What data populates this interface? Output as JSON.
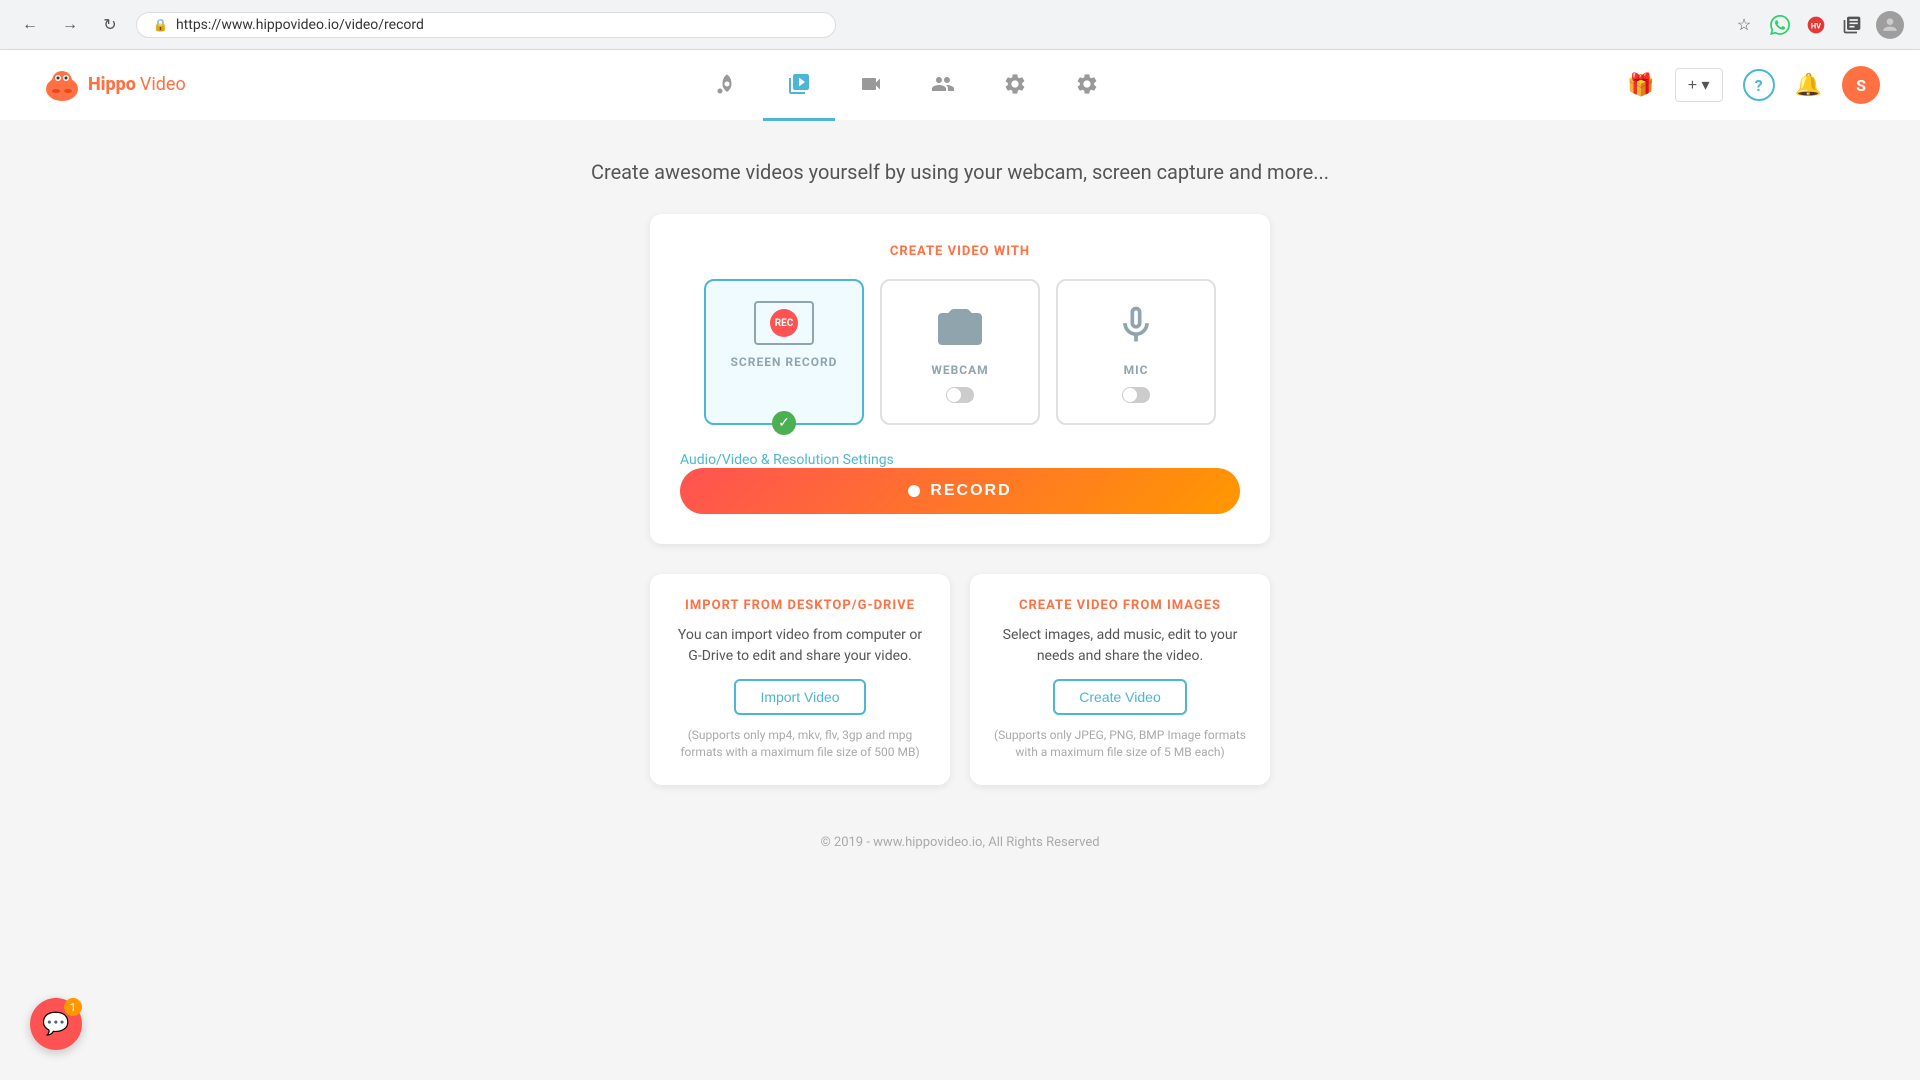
{
  "browser": {
    "url": "https://www.hippovideo.io/video/record",
    "back_title": "Back",
    "forward_title": "Forward",
    "refresh_title": "Refresh"
  },
  "header": {
    "logo_text": "Hippo Video",
    "logo_hippo": "Hippo",
    "logo_video": "Video",
    "nav": {
      "rocket": "🚀",
      "video_library": "📹",
      "video_call": "📽",
      "people": "👥",
      "integrations": "⚙",
      "settings": "⚙"
    },
    "user_initial": "S",
    "plus_label": "+ ▾"
  },
  "main": {
    "subtitle": "Create awesome videos yourself by using your webcam, screen capture and more...",
    "create_card": {
      "label": "CREATE VIDEO WITH",
      "options": [
        {
          "id": "screen-record",
          "label": "SCREEN RECORD",
          "selected": true,
          "toggle_on": false
        },
        {
          "id": "webcam",
          "label": "WEBCAM",
          "selected": false,
          "toggle_on": false
        },
        {
          "id": "mic",
          "label": "MIC",
          "selected": false,
          "toggle_on": false
        }
      ],
      "av_settings": "Audio/Video & Resolution Settings",
      "record_btn": "RECORD"
    },
    "import_card": {
      "title": "IMPORT FROM DESKTOP/G-DRIVE",
      "description": "You can import video from computer or G-Drive to edit and share your video.",
      "btn_label": "Import Video",
      "note": "(Supports only mp4, mkv, flv, 3gp and mpg formats with a maximum file size of 500 MB)"
    },
    "images_card": {
      "title": "CREATE VIDEO FROM IMAGES",
      "description": "Select images, add music, edit to your needs and share the video.",
      "btn_label": "Create Video",
      "note": "(Supports only JPEG, PNG, BMP Image formats with a maximum file size of 5 MB each)"
    }
  },
  "footer": {
    "text": "© 2019 - www.hippovideo.io, All Rights Reserved"
  },
  "chat": {
    "badge": "1"
  }
}
